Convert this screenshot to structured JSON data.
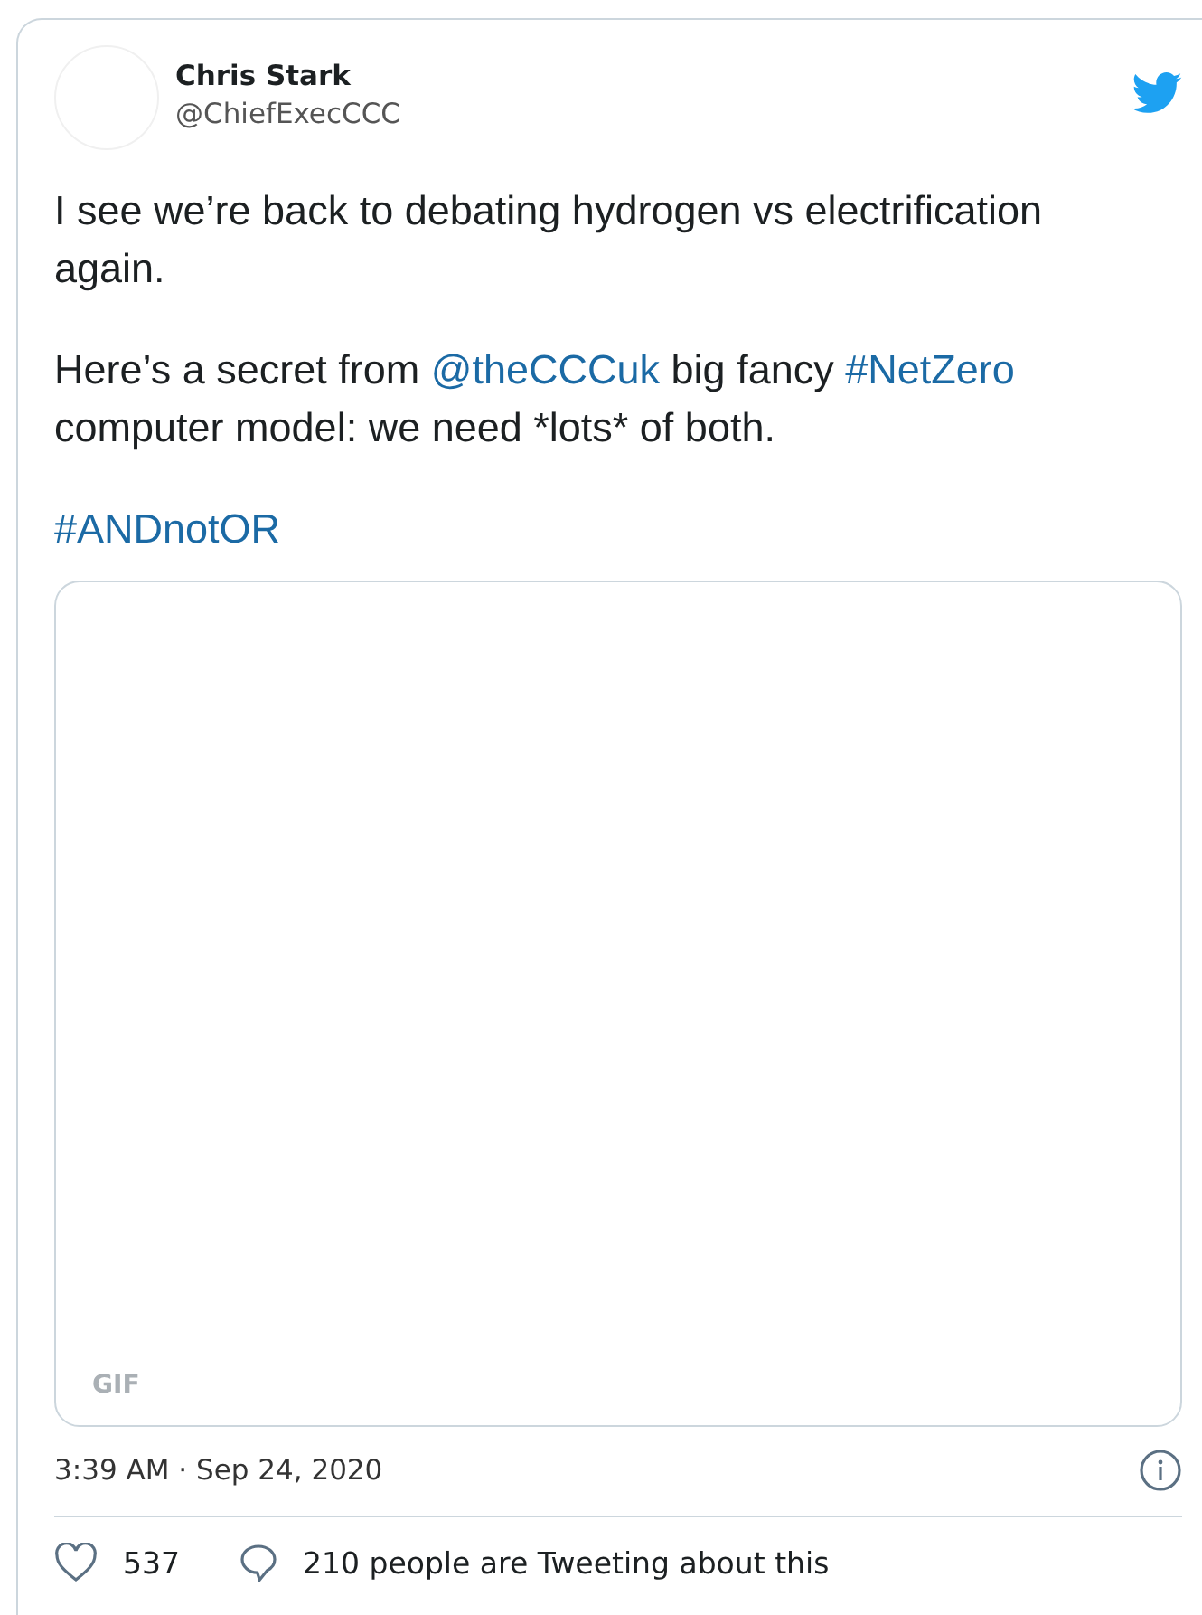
{
  "author": {
    "name": "Chris Stark",
    "handle": "@ChiefExecCCC"
  },
  "paragraphs": [
    [
      {
        "kind": "text",
        "text": "I see we’re back to debating hydrogen vs electrification again."
      }
    ],
    [
      {
        "kind": "text",
        "text": "Here’s a secret from "
      },
      {
        "kind": "link",
        "text": "@theCCCuk"
      },
      {
        "kind": "text",
        "text": " big fancy "
      },
      {
        "kind": "link",
        "text": "#NetZero"
      },
      {
        "kind": "text",
        "text": " computer model: we need *lots* of both."
      }
    ],
    [
      {
        "kind": "link",
        "text": "#ANDnotOR"
      }
    ]
  ],
  "media": {
    "badge": "GIF"
  },
  "timestamp": "3:39 AM · Sep 24, 2020",
  "likes": "537",
  "conversation": "210 people are Tweeting about this"
}
